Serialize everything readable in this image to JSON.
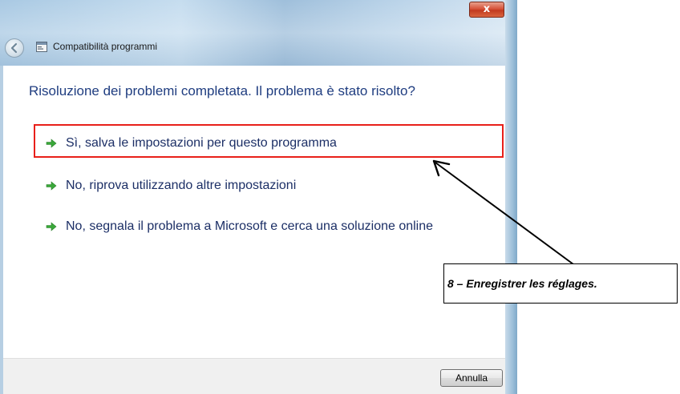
{
  "window": {
    "title": "Compatibilità programmi",
    "close_label": "x"
  },
  "content": {
    "heading": "Risoluzione dei problemi completata. Il problema è stato risolto?",
    "options": [
      {
        "label": "Sì, salva le impostazioni per questo programma",
        "icon": "green-arrow-icon",
        "highlighted": true
      },
      {
        "label": "No, riprova utilizzando altre impostazioni",
        "icon": "green-arrow-icon",
        "highlighted": false
      },
      {
        "label": "No, segnala il problema a Microsoft e cerca una soluzione online",
        "icon": "green-arrow-icon",
        "highlighted": false
      }
    ]
  },
  "footer": {
    "cancel_label": "Annulla"
  },
  "annotation": {
    "text": "8 – Enregistrer les réglages."
  },
  "colors": {
    "heading": "#1f3d80",
    "option_text": "#1c2f66",
    "highlight_border": "#e8201a",
    "arrow_green": "#3aa83a"
  }
}
